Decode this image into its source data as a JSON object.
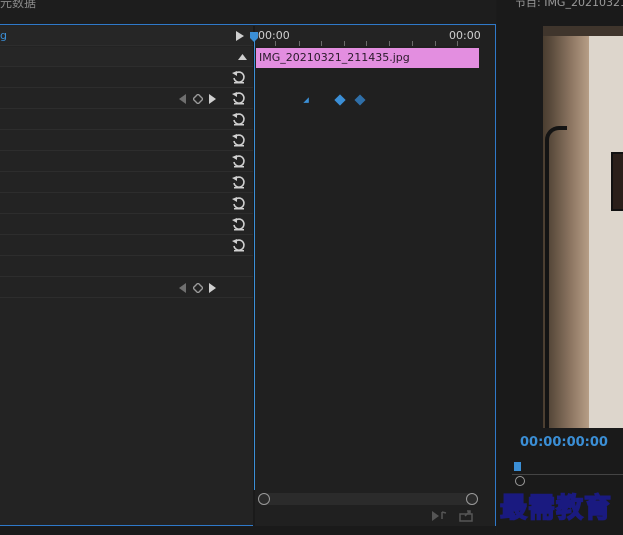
{
  "panel_tab": "元数据",
  "clip_label": "g",
  "timeline": {
    "start_time": "00:00",
    "end_time": "00:00",
    "clip_name": "IMG_20210321_211435.jpg"
  },
  "monitor": {
    "title": "节目: IMG_20210321_",
    "timecode": "00:00:00:00"
  },
  "watermark": "最需教育",
  "icons": {
    "reset": "reset-icon",
    "play": "play-icon",
    "keyframe": "keyframe-icon"
  },
  "colors": {
    "accent": "#3b8fd6",
    "clip": "#e38ee0"
  }
}
